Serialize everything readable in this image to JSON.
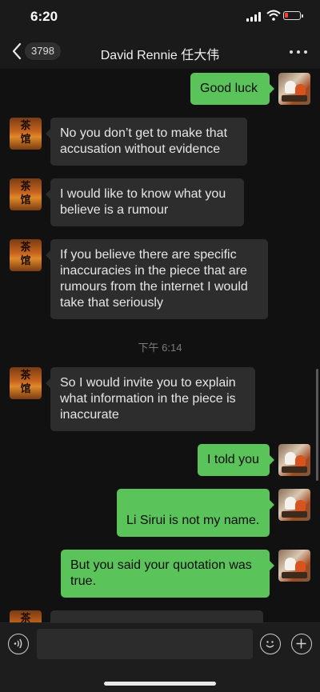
{
  "status_bar": {
    "time": "6:20"
  },
  "nav": {
    "unread_count": "3798",
    "title": "David Rennie 任大伟"
  },
  "avatars": {
    "other_glyph": "茶\n馆"
  },
  "messages": [
    {
      "side": "out",
      "text": "Good luck"
    },
    {
      "side": "in",
      "text": "No you don’t get to make that accusation without evidence"
    },
    {
      "side": "in",
      "text": "I would like to know what you believe is a rumour"
    },
    {
      "side": "in",
      "text": "If you believe there are specific inaccuracies in the piece that are rumours from the internet I would take that seriously"
    },
    {
      "side": "in",
      "text": "So I would invite you to explain what information in the piece is inaccurate"
    },
    {
      "side": "out",
      "text": "I told you"
    },
    {
      "side": "out",
      "text": "Li Sirui is not my name."
    },
    {
      "side": "out",
      "text": "But you said your quotation was true."
    }
  ],
  "timestamp": "下午 6:14",
  "input": {
    "placeholder": ""
  },
  "colors": {
    "bubble_out": "#5ac35a",
    "bubble_in": "#2d2d2d",
    "background": "#111111"
  },
  "icons": [
    "back-chevron-icon",
    "more-dots-icon",
    "voice-icon",
    "emoji-icon",
    "plus-icon",
    "signal-icon",
    "wifi-icon",
    "battery-icon"
  ]
}
